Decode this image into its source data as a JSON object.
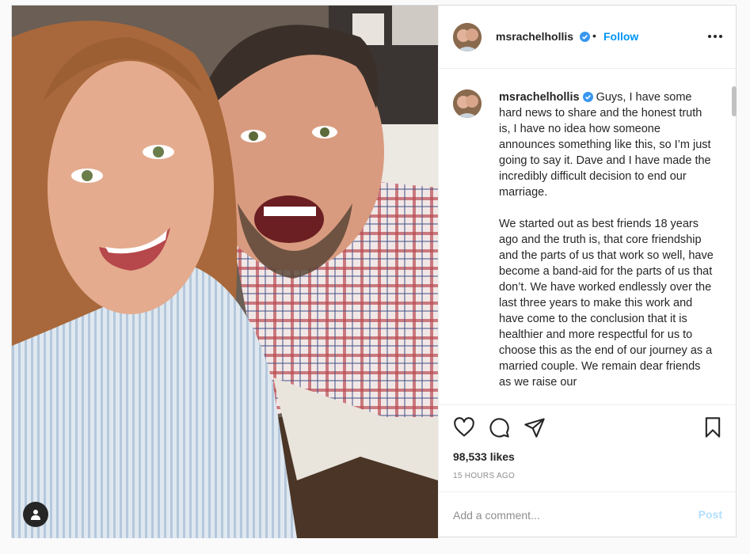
{
  "post": {
    "username": "msrachelhollis",
    "follow_label": "Follow",
    "dot": "•",
    "caption_paragraphs": [
      "Guys, I have some hard news to share and the honest truth is, I have no idea how someone announces something like this, so I’m just going to say it. Dave and I have made the incredibly difficult decision to end our marriage.",
      "We started out as best friends 18 years ago and the truth is, that core friendship and the parts of us that work so well, have become a band-aid for the parts of us that don’t. We have worked endlessly over the last three years to make this work and have come to the conclusion that it is healthier and more respectful for us to choose this as the end of our journey as a married couple. We remain dear friends as we raise our"
    ],
    "likes": "98,533 likes",
    "timestamp": "15 HOURS AGO",
    "comment_placeholder": "Add a comment...",
    "post_button": "Post"
  },
  "icons": {
    "verified": "verified-badge-icon",
    "more": "more-options-icon",
    "like": "heart-icon",
    "comment": "comment-bubble-icon",
    "share": "paper-plane-icon",
    "save": "bookmark-icon",
    "tag": "user-tag-icon"
  },
  "colors": {
    "accent": "#0095f6",
    "post_disabled": "#b2dffc",
    "text": "#262626",
    "muted": "#8e8e8e",
    "border": "#dbdbdb"
  }
}
